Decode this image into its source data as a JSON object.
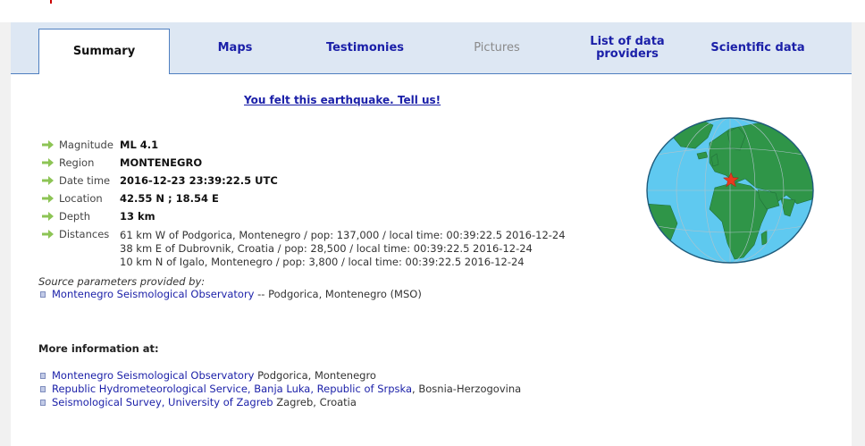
{
  "tabs": [
    {
      "label": "Summary",
      "state": "active"
    },
    {
      "label": "Maps",
      "state": "normal"
    },
    {
      "label": "Testimonies",
      "state": "normal"
    },
    {
      "label": "Pictures",
      "state": "disabled"
    },
    {
      "label_line1": "List of data",
      "label_line2": "providers",
      "state": "normal"
    },
    {
      "label": "Scientific data",
      "state": "normal"
    }
  ],
  "felt_link": "You felt this earthquake. Tell us!",
  "details": [
    {
      "label": "Magnitude",
      "value": "ML 4.1"
    },
    {
      "label": "Region",
      "value": "MONTENEGRO"
    },
    {
      "label": "Date time",
      "value": "2016-12-23 23:39:22.5 UTC"
    },
    {
      "label": "Location",
      "value": "42.55 N ; 18.54 E"
    },
    {
      "label": "Depth",
      "value": "13 km"
    },
    {
      "label": "Distances",
      "lines": [
        "61 km W of Podgorica, Montenegro / pop: 137,000 / local time: 00:39:22.5 2016-12-24",
        "38 km E of Dubrovnik, Croatia / pop: 28,500 / local time: 00:39:22.5 2016-12-24",
        "10 km N of Igalo, Montenegro / pop: 3,800 / local time: 00:39:22.5 2016-12-24"
      ]
    }
  ],
  "source": {
    "note": "Source parameters provided by:",
    "link": "Montenegro Seismological Observatory",
    "suffix": " -- Podgorica, Montenegro (MSO)"
  },
  "more_info": {
    "heading": "More information at:",
    "links": [
      {
        "link": "Montenegro Seismological Observatory",
        "suffix": " Podgorica, Montenegro"
      },
      {
        "link": "Republic Hydrometeorological Service, Banja Luka, Republic of Srpska",
        "suffix": ", Bosnia-Herzogovina"
      },
      {
        "link": "Seismological Survey, University of Zagreb",
        "suffix": " Zagreb, Croatia"
      }
    ]
  },
  "colors": {
    "tab_bar": "#dde7f3",
    "tab_border": "#4f7fc0",
    "link": "#1a1fa8",
    "arrow": "#8dc455",
    "ocean": "#5fc9f0",
    "land": "#2f9548",
    "epicenter": "#e83a1f"
  }
}
